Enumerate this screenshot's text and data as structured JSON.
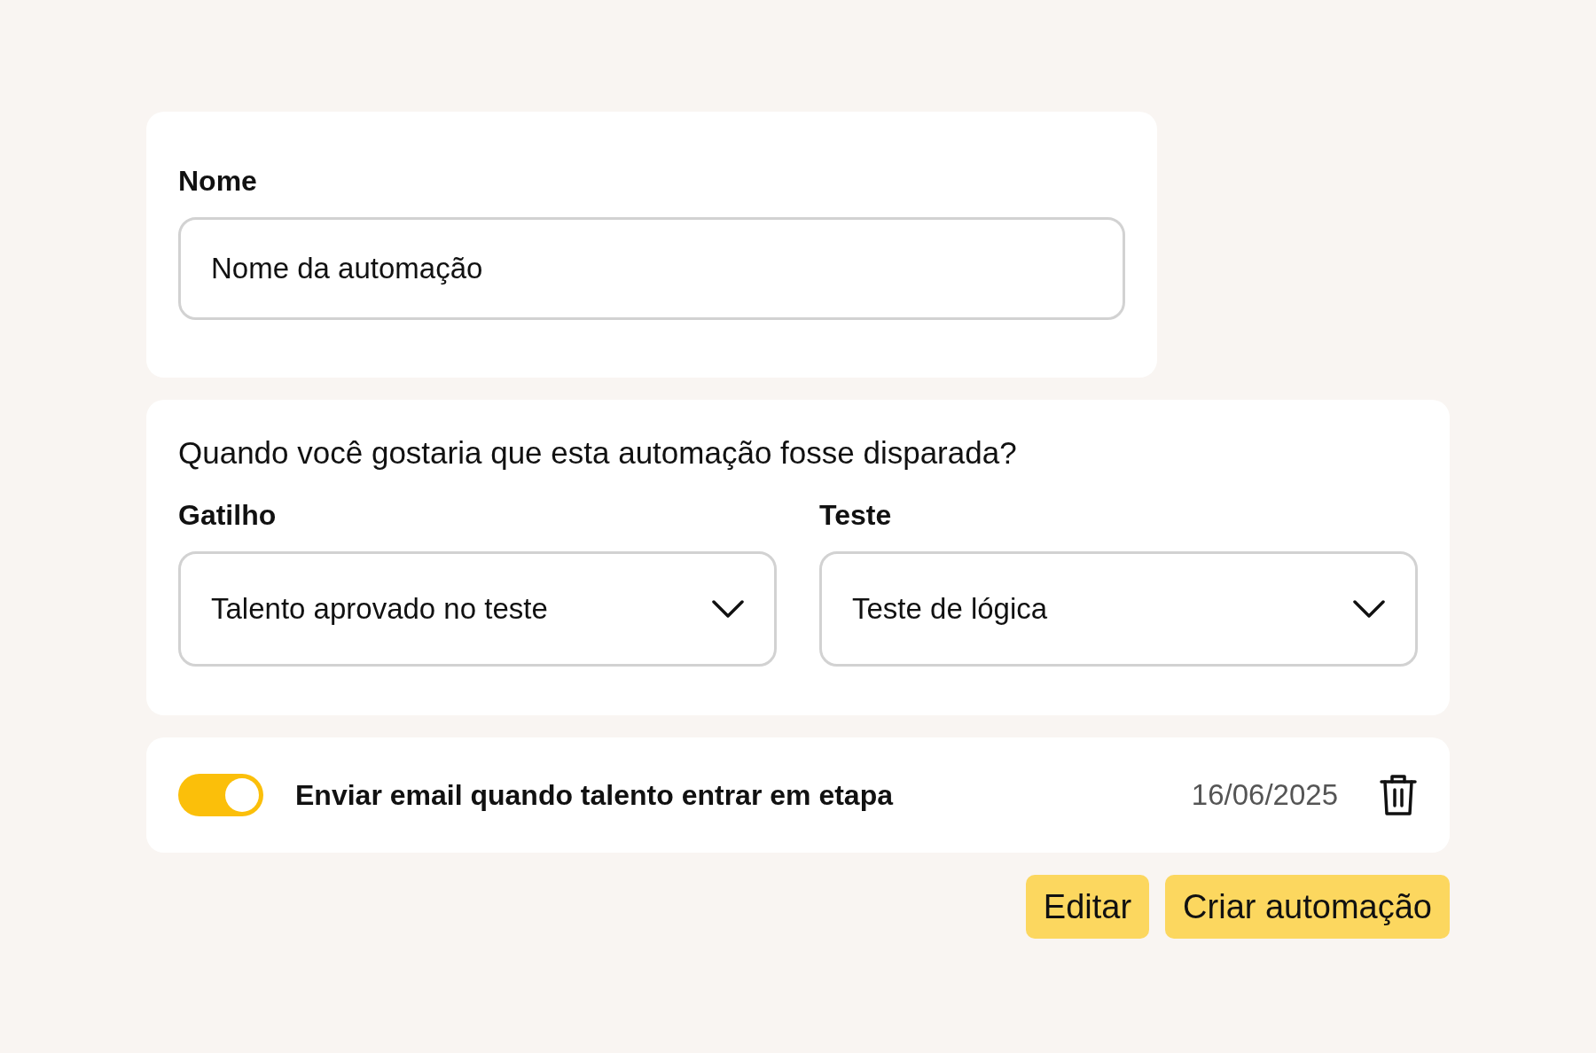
{
  "name_card": {
    "label": "Nome",
    "value": "Nome da automação"
  },
  "trigger_card": {
    "question": "Quando você gostaria que esta automação fosse disparada?",
    "selects": [
      {
        "label": "Gatilho",
        "value": "Talento aprovado no teste"
      },
      {
        "label": "Teste",
        "value": "Teste de lógica"
      }
    ]
  },
  "automation": {
    "on": true,
    "title": "Enviar email quando talento entrar em etapa",
    "date": "16/06/2025"
  },
  "buttons": [
    "Editar",
    "Criar automação"
  ]
}
